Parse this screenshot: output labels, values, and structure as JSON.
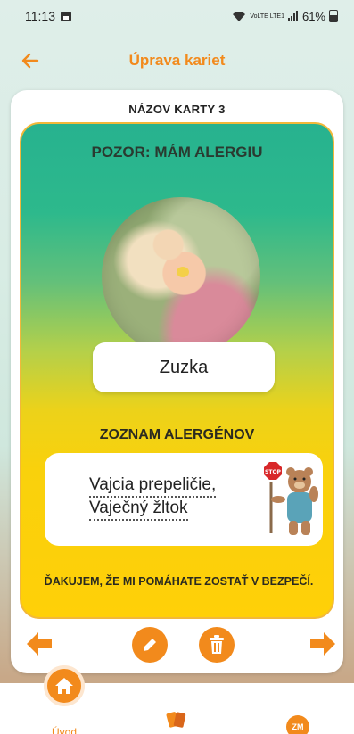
{
  "status_bar": {
    "time": "11:13",
    "network": "VoLTE LTE1",
    "battery": "61%"
  },
  "header": {
    "title": "Úprava kariet"
  },
  "card": {
    "name_label": "NÁZOV KARTY 3",
    "warning_title": "POZOR: MÁM ALERGIU",
    "person_name": "Zuzka",
    "allergen_list_title": "ZOZNAM ALERGÉNOV",
    "allergens": [
      "Vajcia prepeličie,",
      "Vaječný žltok"
    ],
    "thanks_text": "ĎAKUJEM, ŽE MI POMÁHATE ZOSTAŤ V BEZPEČÍ.",
    "stop_sign_text": "STOP"
  },
  "bottom_nav": {
    "home_label": "Úvod",
    "profile_initials": "ZM"
  },
  "colors": {
    "accent": "#f28a1c",
    "card_gradient_top": "#27b28f",
    "card_gradient_bottom": "#ffd008"
  }
}
